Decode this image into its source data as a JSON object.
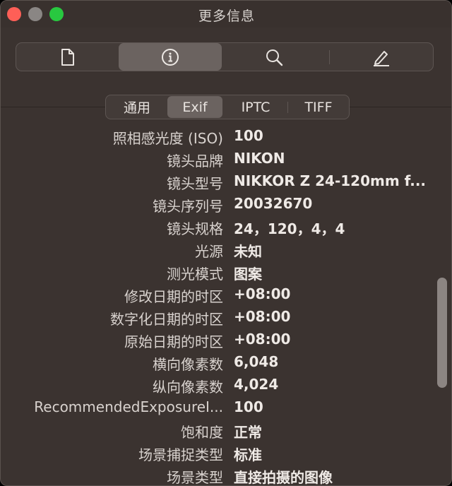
{
  "window": {
    "title": "更多信息"
  },
  "toolbar": {
    "items": [
      {
        "name": "document",
        "icon": "document-icon"
      },
      {
        "name": "info",
        "icon": "info-icon",
        "active": true
      },
      {
        "name": "search",
        "icon": "search-icon"
      },
      {
        "name": "edit",
        "icon": "pencil-icon"
      }
    ]
  },
  "tabs": [
    {
      "label": "通用"
    },
    {
      "label": "Exif",
      "active": true
    },
    {
      "label": "IPTC"
    },
    {
      "label": "TIFF"
    }
  ],
  "rows": [
    {
      "label": "照相感光度 (ISO)",
      "value": "100"
    },
    {
      "label": "镜头品牌",
      "value": "NIKON"
    },
    {
      "label": "镜头型号",
      "value": "NIKKOR Z 24-120mm f..."
    },
    {
      "label": "镜头序列号",
      "value": "20032670"
    },
    {
      "label": "镜头规格",
      "value": "24，120，4，4"
    },
    {
      "label": "光源",
      "value": "未知"
    },
    {
      "label": "测光模式",
      "value": "图案"
    },
    {
      "label": "修改日期的时区",
      "value": "+08:00"
    },
    {
      "label": "数字化日期的时区",
      "value": "+08:00"
    },
    {
      "label": "原始日期的时区",
      "value": "+08:00"
    },
    {
      "label": "横向像素数",
      "value": "6,048"
    },
    {
      "label": "纵向像素数",
      "value": "4,024"
    },
    {
      "label": "RecommendedExposureI...",
      "value": "100"
    },
    {
      "label": "饱和度",
      "value": "正常"
    },
    {
      "label": "场景捕捉类型",
      "value": "标准"
    },
    {
      "label": "场景类型",
      "value": "直接拍摄的图像"
    }
  ],
  "colors": {
    "background": "#3b3330",
    "accent_active": "#6b6360",
    "close": "#fe5f57",
    "maximize": "#28c840"
  }
}
